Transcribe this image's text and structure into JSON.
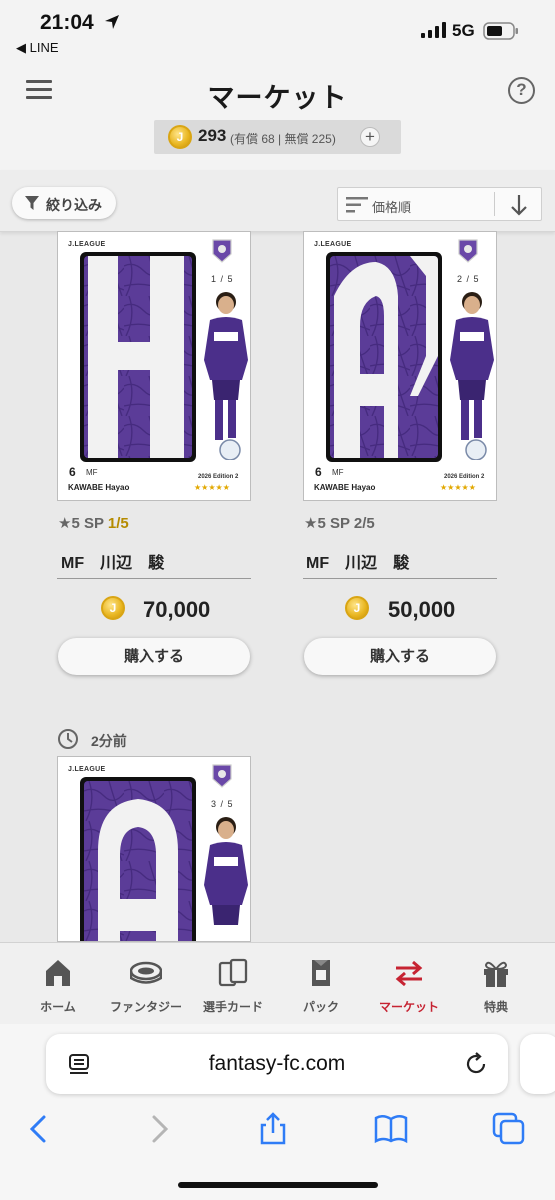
{
  "status_bar": {
    "time": "21:04",
    "back_app": "◀ LINE",
    "network": "5G"
  },
  "header": {
    "title": "マーケット",
    "coin_total": "293",
    "coin_detail": "(有償 68 | 無償 225)",
    "plus": "+",
    "help": "?"
  },
  "filter": {
    "label": "絞り込み"
  },
  "sort": {
    "label": "価格順"
  },
  "listings": [
    {
      "league": "J.LEAGUE",
      "serial": "1 / 5",
      "number": "6",
      "pos_short": "MF",
      "name_en": "KAWABE Hayao",
      "edition": "2026 Edition 2",
      "stars": "★★★★★",
      "rarity": "★5 SP",
      "serial_no": "1/5",
      "player": "MF　川辺　駿",
      "price": "70,000",
      "buy": "購入する"
    },
    {
      "league": "J.LEAGUE",
      "serial": "2 / 5",
      "number": "6",
      "pos_short": "MF",
      "name_en": "KAWABE Hayao",
      "edition": "2026 Edition 2",
      "stars": "★★★★★",
      "rarity": "★5 SP",
      "serial_no": "2/5",
      "player": "MF　川辺　駿",
      "price": "50,000",
      "buy": "購入する"
    },
    {
      "ago": "2分前",
      "league": "J.LEAGUE",
      "serial": "3 / 5"
    }
  ],
  "coin_glyph": "J",
  "tabs": [
    {
      "label": "ホーム",
      "icon": "home-icon"
    },
    {
      "label": "ファンタジー",
      "icon": "stadium-icon"
    },
    {
      "label": "選手カード",
      "icon": "cards-icon"
    },
    {
      "label": "パック",
      "icon": "pack-icon"
    },
    {
      "label": "マーケット",
      "icon": "exchange-icon",
      "active": true
    },
    {
      "label": "特典",
      "icon": "gift-icon"
    }
  ],
  "browser": {
    "url": "fantasy-fc.com"
  },
  "colors": {
    "accent": "#c62332",
    "card_purple": "#5b3c98",
    "coin_gold": "#e8b51f",
    "serial_gold": "#b58b00"
  }
}
